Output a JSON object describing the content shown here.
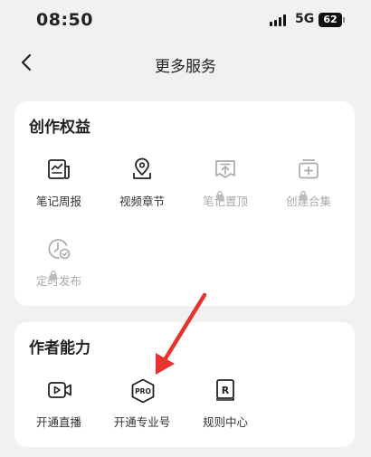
{
  "status_bar": {
    "time": "08:50",
    "network": "5G",
    "battery": "62"
  },
  "nav": {
    "title": "更多服务"
  },
  "creation_rights": {
    "title": "创作权益",
    "items": [
      {
        "label": "笔记周报",
        "icon": "newspaper-chart-icon",
        "locked": false
      },
      {
        "label": "视频章节",
        "icon": "map-pin-icon",
        "locked": false
      },
      {
        "label": "笔记置顶",
        "icon": "pin-to-top-icon",
        "locked": true
      },
      {
        "label": "创建合集",
        "icon": "collection-add-icon",
        "locked": true
      },
      {
        "label": "定时发布",
        "icon": "scheduled-clock-icon",
        "locked": true
      }
    ]
  },
  "author_abilities": {
    "title": "作者能力",
    "items": [
      {
        "label": "开通直播",
        "icon": "live-camera-icon",
        "locked": false
      },
      {
        "label": "开通专业号",
        "icon": "pro-badge-icon",
        "badge_text": "PRO",
        "locked": false
      },
      {
        "label": "规则中心",
        "icon": "rules-book-icon",
        "badge_text": "R",
        "locked": false
      }
    ]
  },
  "colors": {
    "background": "#f1f1f1",
    "card": "#ffffff",
    "disabled": "#aaaaaa",
    "arrow": "#e8322e"
  }
}
